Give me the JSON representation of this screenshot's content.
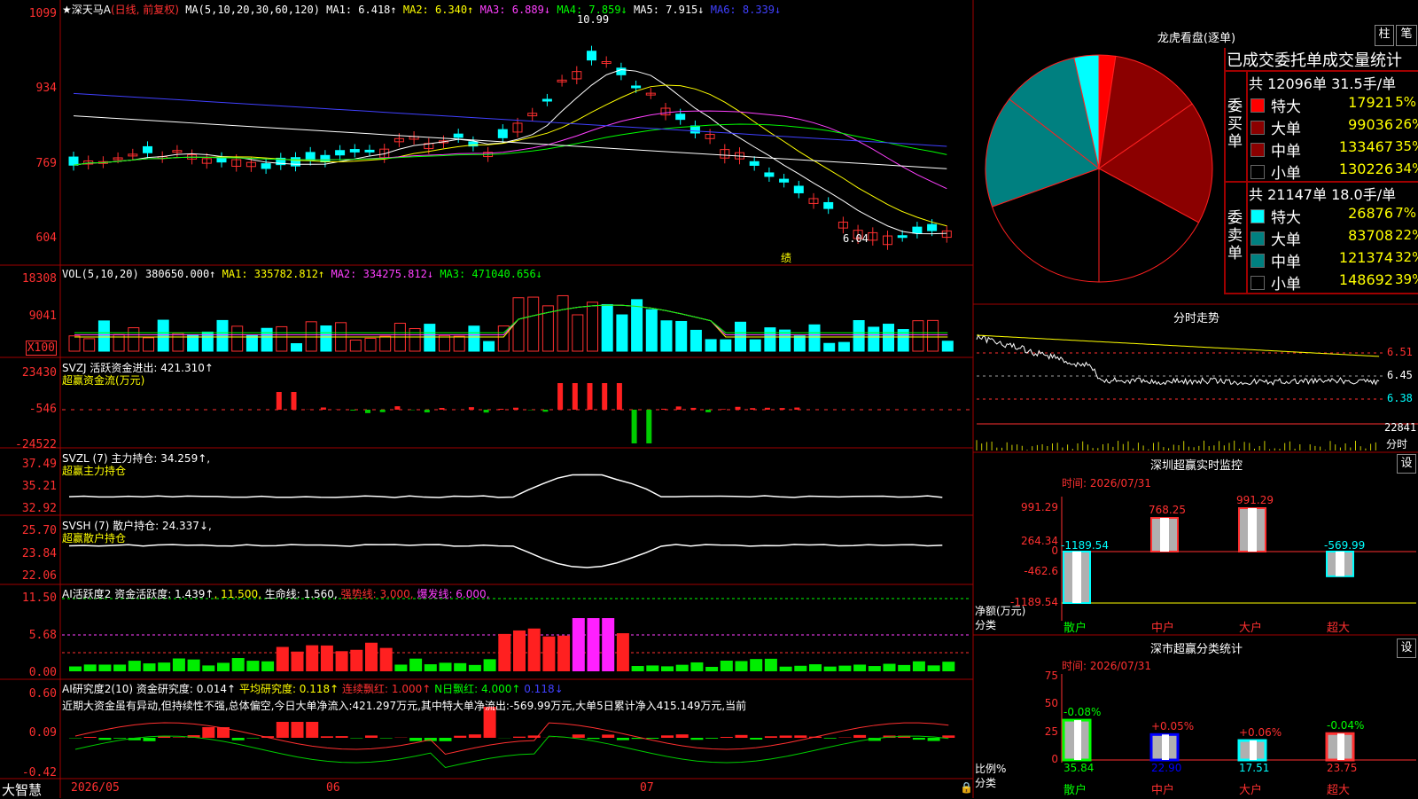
{
  "header": {
    "stock_name": "★深天马A",
    "mode": "(日线, 前复权)",
    "ma_params": "MA(5,10,20,30,60,120)",
    "ma1": "MA1: 6.418↑",
    "ma2": "MA2: 6.340↑",
    "ma3": "MA3: 6.889↓",
    "ma4": "MA4: 7.859↓",
    "ma5": "MA5: 7.915↓",
    "ma6": "MA6: 8.339↓"
  },
  "main_chart": {
    "y_ticks": [
      "1099",
      "934",
      "769",
      "604"
    ],
    "high_label": "10.99",
    "low_label": "6.04",
    "event_label": "绩"
  },
  "vol_panel": {
    "title": "VOL(5,10,20)",
    "value": "380650.000↑",
    "ma1": "MA1: 335782.812↑",
    "ma2": "MA2: 334275.812↓",
    "ma3": "MA3: 471040.656↓",
    "y_ticks": [
      "18308",
      "9041"
    ],
    "unit": "X100"
  },
  "svzj_panel": {
    "title": "SVZJ  活跃资金进出: 421.310↑",
    "subtitle": "超赢资金流(万元)",
    "y_ticks": [
      "23430",
      "-546",
      "-24522"
    ]
  },
  "svzl_panel": {
    "title": "SVZL (7) 主力持仓: 34.259↑,",
    "subtitle": "超赢主力持仓",
    "y_ticks": [
      "37.49",
      "35.21",
      "32.92"
    ]
  },
  "svsh_panel": {
    "title": "SVSH (7) 散户持仓: 24.337↓,",
    "subtitle": "超赢散户持仓",
    "y_ticks": [
      "25.70",
      "23.84",
      "22.06"
    ]
  },
  "ai_active_panel": {
    "title": "AI活跃度2 资金活跃度: 1.439↑",
    "v2": ", 11.500,",
    "v3": "生命线: 1.560,",
    "v4": "强势线: 3.000,",
    "v5": "爆发线: 6.000,",
    "y_ticks": [
      "11.50",
      "5.68",
      "0.00"
    ]
  },
  "ai_research_panel": {
    "title": "AI研究度2(10) 资金研究度: 0.014↑",
    "v2": "平均研究度: 0.118↑",
    "v3": "连续飘红: 1.000↑",
    "v4": "N日飘红: 4.000↑",
    "v5": "0.118↓",
    "comment": "近期大资金虽有异动,但持续性不强,总体偏空,今日大单净流入:421.297万元,其中特大单净流出:-569.99万元,大单5日累计净入415.149万元,当前",
    "y_ticks": [
      "0.60",
      "0.09",
      "-0.42"
    ]
  },
  "time_axis": {
    "labels": [
      "2026/05",
      "06",
      "07"
    ],
    "brand": "大智慧"
  },
  "dragon_tiger": {
    "title": "龙虎看盘(逐单)",
    "btn_bar": "柱",
    "btn_line": "笔",
    "stats_title": "已成交委托单成交量统计",
    "buy_header": "共 12096单 31.5手/单",
    "sell_header": "共 21147单 18.0手/单",
    "buy_label": "委买单",
    "sell_label": "委卖单",
    "buy_rows": [
      {
        "name": "特大",
        "value": "17921",
        "pct": "5%",
        "color": "#ff0000"
      },
      {
        "name": "大单",
        "value": "99036",
        "pct": "26%",
        "color": "#8b0000"
      },
      {
        "name": "中单",
        "value": "133467",
        "pct": "35%",
        "color": "#8b0000"
      },
      {
        "name": "小单",
        "value": "130226",
        "pct": "34%",
        "color": "#000000"
      }
    ],
    "sell_rows": [
      {
        "name": "特大",
        "value": "26876",
        "pct": "7%",
        "color": "#00ffff"
      },
      {
        "name": "大单",
        "value": "83708",
        "pct": "22%",
        "color": "#008080"
      },
      {
        "name": "中单",
        "value": "121374",
        "pct": "32%",
        "color": "#008080"
      },
      {
        "name": "小单",
        "value": "148692",
        "pct": "39%",
        "color": "#000000"
      }
    ]
  },
  "intraday": {
    "title": "分时走势",
    "prices": [
      "6.51",
      "6.45",
      "6.38"
    ],
    "vol": "22841",
    "vol_label": "分时"
  },
  "monitor": {
    "title": "深圳超赢实时监控",
    "btn": "设",
    "time": "时间: 2026/07/31",
    "y_ticks": [
      "991.29",
      "264.34",
      "0",
      "-462.6",
      "-1189.54"
    ],
    "ylabel_1": "净额(万元)",
    "ylabel_2": "分类",
    "bars": [
      {
        "cat": "散户",
        "value": -1189.54,
        "label": "-1189.54"
      },
      {
        "cat": "中户",
        "value": 768.25,
        "label": "768.25"
      },
      {
        "cat": "大户",
        "value": 991.29,
        "label": "991.29"
      },
      {
        "cat": "超大",
        "value": -569.99,
        "label": "-569.99"
      }
    ]
  },
  "classify": {
    "title": "深市超赢分类统计",
    "btn": "设",
    "time": "时间: 2026/07/31",
    "y_ticks": [
      "75",
      "50",
      "25",
      "0"
    ],
    "ylabel_1": "比例%",
    "ylabel_2": "分类",
    "bars": [
      {
        "cat": "散户",
        "value": 35.84,
        "label": "35.84",
        "delta": "-0.08%"
      },
      {
        "cat": "中户",
        "value": 22.9,
        "label": "22.90",
        "delta": "+0.05%"
      },
      {
        "cat": "大户",
        "value": 17.51,
        "label": "17.51",
        "delta": "+0.06%"
      },
      {
        "cat": "超大",
        "value": 23.75,
        "label": "23.75",
        "delta": "-0.04%"
      }
    ]
  },
  "chart_data": [
    {
      "type": "pie",
      "title": "龙虎看盘(逐单)",
      "labels": [
        "买特大",
        "买大单",
        "买中单",
        "买小单",
        "卖小单",
        "卖中单",
        "卖大单",
        "卖特大"
      ],
      "values": [
        17921,
        99036,
        133467,
        130226,
        148692,
        121374,
        83708,
        26876
      ]
    },
    {
      "type": "bar",
      "title": "深圳超赢实时监控",
      "categories": [
        "散户",
        "中户",
        "大户",
        "超大"
      ],
      "values": [
        -1189.54,
        768.25,
        991.29,
        -569.99
      ],
      "ylabel": "净额(万元)",
      "ylim": [
        -1189.54,
        991.29
      ]
    },
    {
      "type": "bar",
      "title": "深市超赢分类统计",
      "categories": [
        "散户",
        "中户",
        "大户",
        "超大"
      ],
      "values": [
        35.84,
        22.9,
        17.51,
        23.75
      ],
      "ylabel": "比例%",
      "ylim": [
        0,
        75
      ]
    }
  ]
}
